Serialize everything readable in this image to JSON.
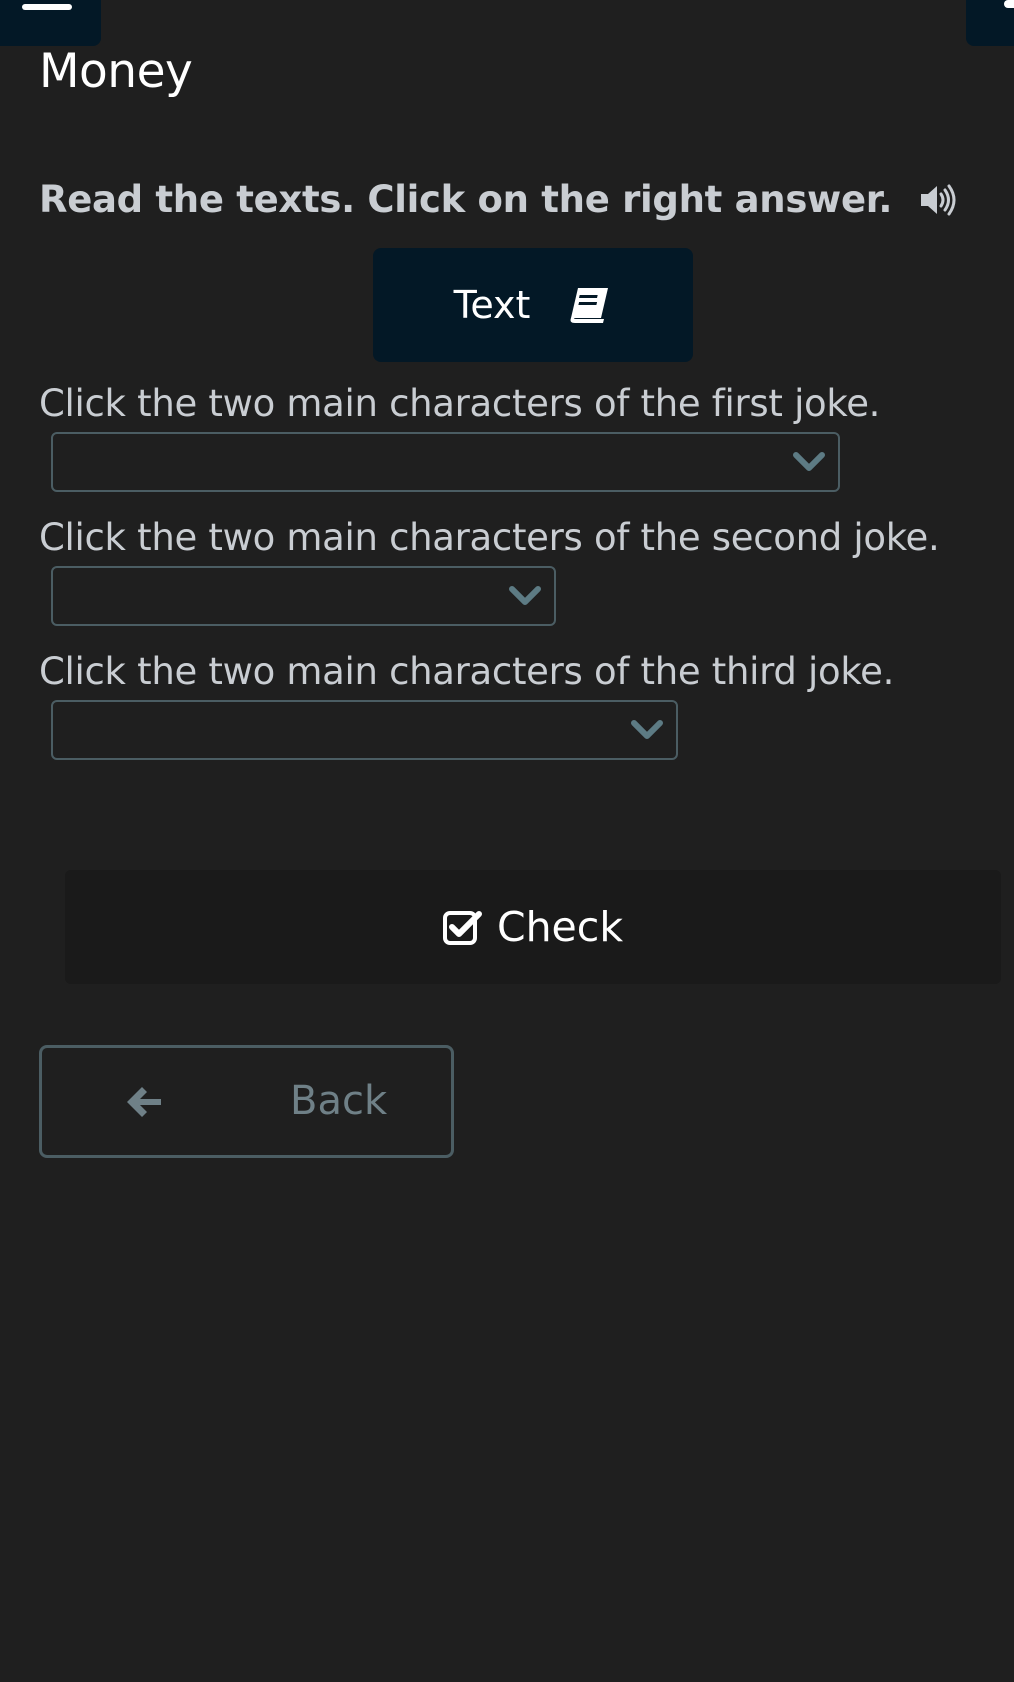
{
  "header": {
    "menu_icon": "hamburger-icon",
    "page_title": "Money"
  },
  "instruction": {
    "text": "Read the texts. Click on the right answer.",
    "audio_icon": "speaker-icon"
  },
  "text_button": {
    "label": "Text",
    "icon": "book-icon"
  },
  "questions": [
    {
      "text": "Click the two main characters of the first joke.",
      "selected_value": ""
    },
    {
      "text": "Click the two main characters of the second joke.",
      "selected_value": ""
    },
    {
      "text": "Click the two main characters of the third joke.",
      "selected_value": ""
    }
  ],
  "check_button": {
    "label": "Check",
    "icon": "check-square-icon"
  },
  "back_button": {
    "label": "Back",
    "icon": "arrow-left-icon"
  },
  "colors": {
    "background": "#1f1f1f",
    "dark_navy": "#031826",
    "select_border": "#4b5d63",
    "chevron": "#5d7b84",
    "muted_text": "#6f8087"
  }
}
